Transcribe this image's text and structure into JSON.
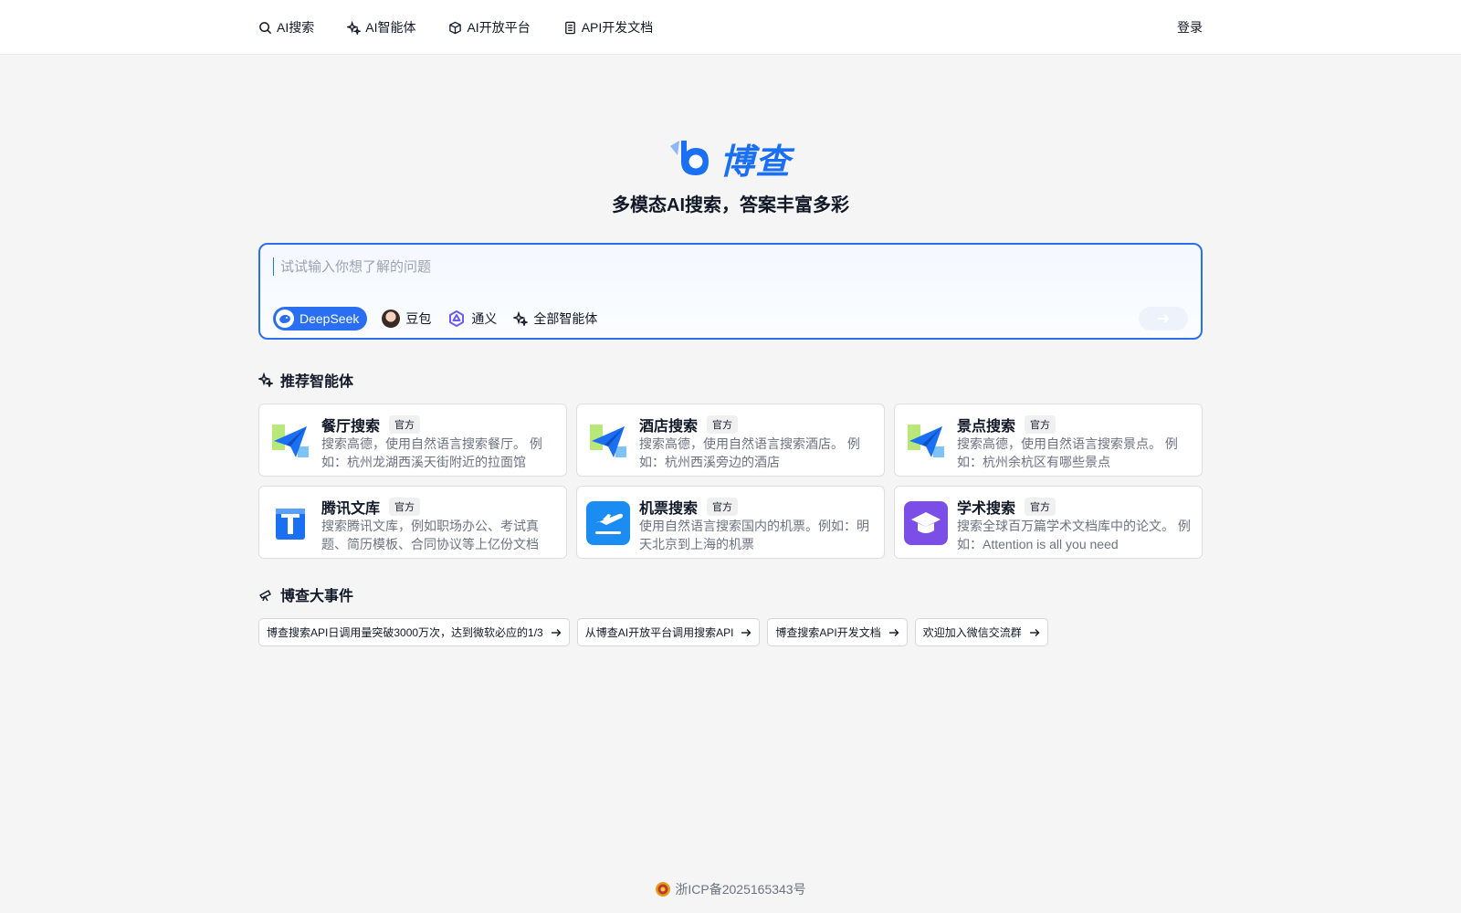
{
  "nav": {
    "items": [
      {
        "label": "AI搜索",
        "icon": "search-icon"
      },
      {
        "label": "AI智能体",
        "icon": "sparkles-icon"
      },
      {
        "label": "AI开放平台",
        "icon": "cube-icon"
      },
      {
        "label": "API开发文档",
        "icon": "document-icon"
      }
    ],
    "login_label": "登录"
  },
  "brand": {
    "logo_text": "博查",
    "slogan": "多模态AI搜索，答案丰富多彩",
    "accent_color": "#1a6ff2"
  },
  "search": {
    "placeholder": "试试输入你想了解的问题",
    "value": "",
    "models": [
      {
        "label": "DeepSeek",
        "icon": "deepseek-icon",
        "active": true
      },
      {
        "label": "豆包",
        "icon": "doubao-avatar-icon",
        "active": false
      },
      {
        "label": "通义",
        "icon": "tongyi-icon",
        "active": false
      },
      {
        "label": "全部智能体",
        "icon": "sparkles-icon",
        "active": false
      }
    ],
    "send_icon": "arrow-right-icon"
  },
  "agents": {
    "title": "推荐智能体",
    "badge": "官方",
    "items": [
      {
        "title": "餐厅搜索",
        "desc": "搜索高德，使用自然语言搜索餐厅。 例如：杭州龙湖西溪天街附近的拉面馆",
        "icon": "paper-plane-icon"
      },
      {
        "title": "酒店搜索",
        "desc": "搜索高德，使用自然语言搜索酒店。 例如：杭州西溪旁边的酒店",
        "icon": "paper-plane-icon"
      },
      {
        "title": "景点搜索",
        "desc": "搜索高德，使用自然语言搜索景点。 例如：杭州余杭区有哪些景点",
        "icon": "paper-plane-icon"
      },
      {
        "title": "腾讯文库",
        "desc": "搜索腾讯文库，例如职场办公、考试真题、简历模板、合同协议等上亿份文档",
        "icon": "tencent-doc-icon"
      },
      {
        "title": "机票搜索",
        "desc": "使用自然语言搜索国内的机票。例如：明天北京到上海的机票",
        "icon": "airplane-icon"
      },
      {
        "title": "学术搜索",
        "desc": "搜索全球百万篇学术文档库中的论文。 例如：Attention is all you need",
        "icon": "graduation-cap-icon"
      }
    ]
  },
  "events": {
    "title": "博查大事件",
    "items": [
      {
        "label": "博查搜索API日调用量突破3000万次，达到微软必应的1/3"
      },
      {
        "label": "从博查AI开放平台调用搜索API"
      },
      {
        "label": "博查搜索API开发文档"
      },
      {
        "label": "欢迎加入微信交流群"
      }
    ]
  },
  "footer": {
    "icp": "浙ICP备2025165343号",
    "icon": "police-badge-icon"
  }
}
